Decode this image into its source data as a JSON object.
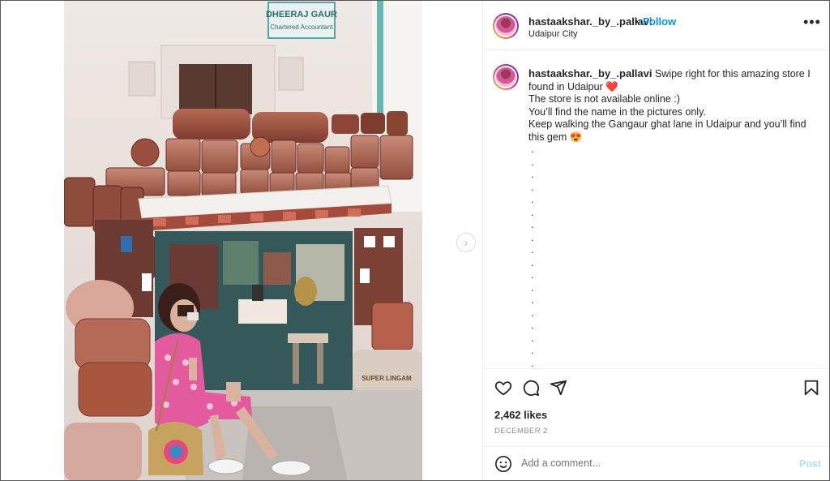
{
  "post": {
    "username": "hastaakshar._by_.pallavi",
    "follow_label": "Follow",
    "dot": "•",
    "location": "Udaipur City",
    "more_label": "•••"
  },
  "photo": {
    "sign_line1": "DHEERAJ GAUR",
    "sign_line2": "Chartered Accountant",
    "sack_label": "SUPER LINGAM"
  },
  "caption": {
    "username": "hastaakshar._by_.pallavi",
    "line1": " Swipe right for this amazing store I found in Udaipur ",
    "heart_emoji": "❤️",
    "line2": "The store is not available online :)",
    "line3": "You’ll find the name in the pictures only.",
    "line4": "Keep walking the Gangaur ghat lane in Udaipur and you’ll find this gem ",
    "heart_eyes_emoji": "😍",
    "dots": [
      ".",
      ".",
      ".",
      ".",
      ".",
      ".",
      ".",
      ".",
      ".",
      ".",
      ".",
      ".",
      ".",
      ".",
      ".",
      ".",
      ".",
      "."
    ]
  },
  "stats": {
    "likes": "2,462 likes",
    "date": "DECEMBER 2"
  },
  "comment": {
    "placeholder": "Add a comment...",
    "post_label": "Post"
  },
  "icons": {
    "like": "heart-icon",
    "comment": "comment-icon",
    "share": "share-icon",
    "save": "bookmark-icon",
    "emoji": "emoji-icon",
    "next": "chevron-right-icon"
  },
  "colors": {
    "accent": "#0095f6",
    "post_disabled": "#b2dffc",
    "text": "#262626",
    "muted": "#8e8e8e"
  }
}
